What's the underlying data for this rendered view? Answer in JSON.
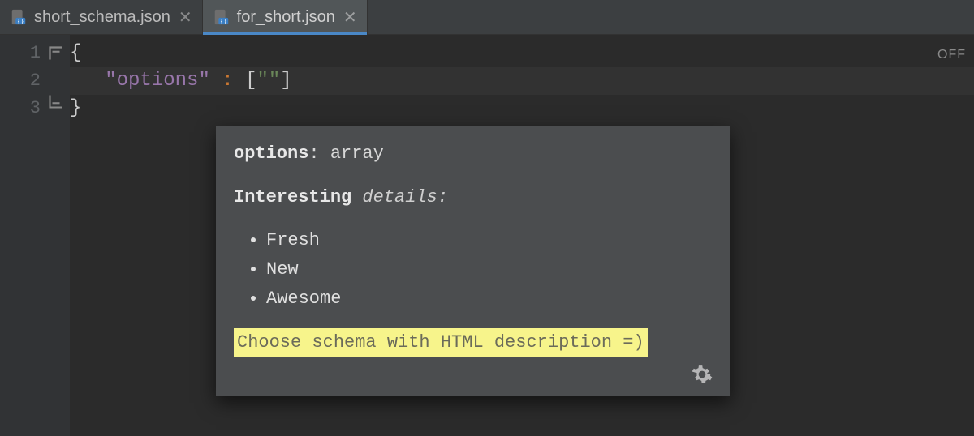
{
  "tabs": [
    {
      "label": "short_schema.json",
      "active": false
    },
    {
      "label": "for_short.json",
      "active": true
    }
  ],
  "gutter": [
    "1",
    "2",
    "3"
  ],
  "code": {
    "line1": "{",
    "line2_key": "\"options\"",
    "line2_colon": " : ",
    "line2_open": "[",
    "line2_str": "\"\"",
    "line2_close": "]",
    "line3": "}"
  },
  "off_badge": "OFF",
  "popup": {
    "header_key": "options",
    "header_type": ": array",
    "sub_bold": "Interesting",
    "sub_italic": " details:",
    "bullets": [
      "Fresh",
      "New",
      "Awesome"
    ],
    "highlight": "Choose schema with HTML description =)"
  }
}
